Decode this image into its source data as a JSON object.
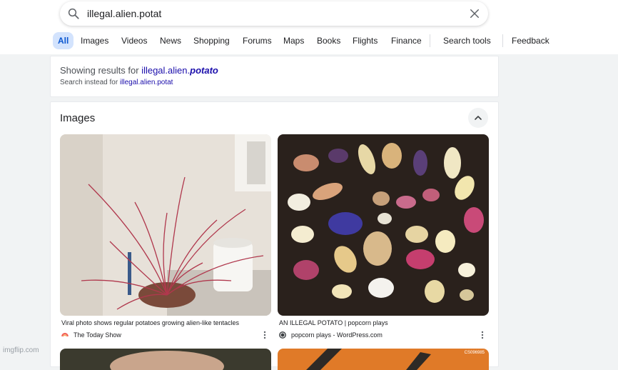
{
  "search": {
    "query": "illegal.alien.potat"
  },
  "tabs": [
    {
      "label": "All",
      "active": true
    },
    {
      "label": "Images"
    },
    {
      "label": "Videos"
    },
    {
      "label": "News"
    },
    {
      "label": "Shopping"
    },
    {
      "label": "Forums"
    },
    {
      "label": "Maps"
    },
    {
      "label": "Books"
    },
    {
      "label": "Flights"
    },
    {
      "label": "Finance"
    }
  ],
  "tools": {
    "search_tools": "Search tools",
    "feedback": "Feedback"
  },
  "correction": {
    "showing_prefix": "Showing results for",
    "corrected_plain": "illegal.alien.",
    "corrected_bold": "potato",
    "instead_prefix": "Search instead for",
    "original_query": "illegal.alien.potat"
  },
  "images_section": {
    "title": "Images",
    "results": [
      {
        "title": "Viral photo shows regular potatoes growing alien-like tentacles",
        "source": "The Today Show",
        "source_icon": "rainbow-logo-icon"
      },
      {
        "title": "AN ILLEGAL POTATO | popcorn plays",
        "source": "popcorn plays - WordPress.com",
        "source_icon": "wordpress-icon"
      }
    ],
    "partial_caption": "CS096985"
  },
  "watermark": "imgflip.com",
  "colors": {
    "accent": "#0b57d0",
    "active_tab_bg": "#d3e3fd",
    "link": "#1a0dab",
    "page_bg": "#f1f3f4"
  }
}
